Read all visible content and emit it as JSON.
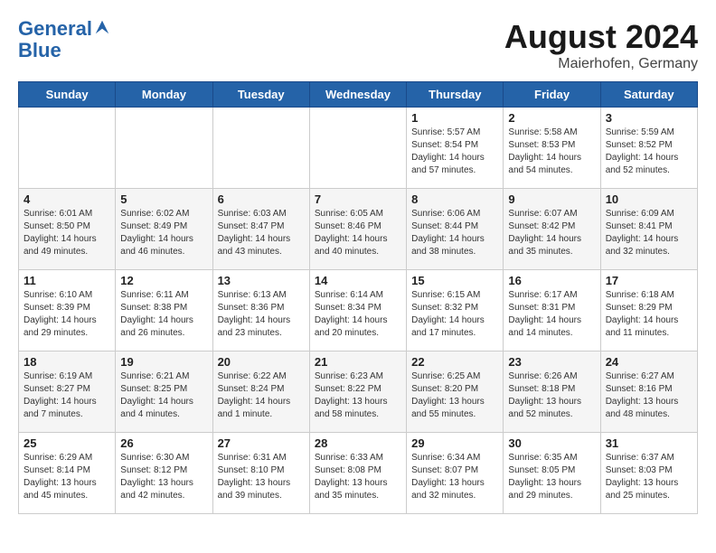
{
  "header": {
    "logo_line1": "General",
    "logo_line2": "Blue",
    "month_year": "August 2024",
    "location": "Maierhofen, Germany"
  },
  "weekdays": [
    "Sunday",
    "Monday",
    "Tuesday",
    "Wednesday",
    "Thursday",
    "Friday",
    "Saturday"
  ],
  "weeks": [
    [
      {
        "day": "",
        "info": ""
      },
      {
        "day": "",
        "info": ""
      },
      {
        "day": "",
        "info": ""
      },
      {
        "day": "",
        "info": ""
      },
      {
        "day": "1",
        "info": "Sunrise: 5:57 AM\nSunset: 8:54 PM\nDaylight: 14 hours\nand 57 minutes."
      },
      {
        "day": "2",
        "info": "Sunrise: 5:58 AM\nSunset: 8:53 PM\nDaylight: 14 hours\nand 54 minutes."
      },
      {
        "day": "3",
        "info": "Sunrise: 5:59 AM\nSunset: 8:52 PM\nDaylight: 14 hours\nand 52 minutes."
      }
    ],
    [
      {
        "day": "4",
        "info": "Sunrise: 6:01 AM\nSunset: 8:50 PM\nDaylight: 14 hours\nand 49 minutes."
      },
      {
        "day": "5",
        "info": "Sunrise: 6:02 AM\nSunset: 8:49 PM\nDaylight: 14 hours\nand 46 minutes."
      },
      {
        "day": "6",
        "info": "Sunrise: 6:03 AM\nSunset: 8:47 PM\nDaylight: 14 hours\nand 43 minutes."
      },
      {
        "day": "7",
        "info": "Sunrise: 6:05 AM\nSunset: 8:46 PM\nDaylight: 14 hours\nand 40 minutes."
      },
      {
        "day": "8",
        "info": "Sunrise: 6:06 AM\nSunset: 8:44 PM\nDaylight: 14 hours\nand 38 minutes."
      },
      {
        "day": "9",
        "info": "Sunrise: 6:07 AM\nSunset: 8:42 PM\nDaylight: 14 hours\nand 35 minutes."
      },
      {
        "day": "10",
        "info": "Sunrise: 6:09 AM\nSunset: 8:41 PM\nDaylight: 14 hours\nand 32 minutes."
      }
    ],
    [
      {
        "day": "11",
        "info": "Sunrise: 6:10 AM\nSunset: 8:39 PM\nDaylight: 14 hours\nand 29 minutes."
      },
      {
        "day": "12",
        "info": "Sunrise: 6:11 AM\nSunset: 8:38 PM\nDaylight: 14 hours\nand 26 minutes."
      },
      {
        "day": "13",
        "info": "Sunrise: 6:13 AM\nSunset: 8:36 PM\nDaylight: 14 hours\nand 23 minutes."
      },
      {
        "day": "14",
        "info": "Sunrise: 6:14 AM\nSunset: 8:34 PM\nDaylight: 14 hours\nand 20 minutes."
      },
      {
        "day": "15",
        "info": "Sunrise: 6:15 AM\nSunset: 8:32 PM\nDaylight: 14 hours\nand 17 minutes."
      },
      {
        "day": "16",
        "info": "Sunrise: 6:17 AM\nSunset: 8:31 PM\nDaylight: 14 hours\nand 14 minutes."
      },
      {
        "day": "17",
        "info": "Sunrise: 6:18 AM\nSunset: 8:29 PM\nDaylight: 14 hours\nand 11 minutes."
      }
    ],
    [
      {
        "day": "18",
        "info": "Sunrise: 6:19 AM\nSunset: 8:27 PM\nDaylight: 14 hours\nand 7 minutes."
      },
      {
        "day": "19",
        "info": "Sunrise: 6:21 AM\nSunset: 8:25 PM\nDaylight: 14 hours\nand 4 minutes."
      },
      {
        "day": "20",
        "info": "Sunrise: 6:22 AM\nSunset: 8:24 PM\nDaylight: 14 hours\nand 1 minute."
      },
      {
        "day": "21",
        "info": "Sunrise: 6:23 AM\nSunset: 8:22 PM\nDaylight: 13 hours\nand 58 minutes."
      },
      {
        "day": "22",
        "info": "Sunrise: 6:25 AM\nSunset: 8:20 PM\nDaylight: 13 hours\nand 55 minutes."
      },
      {
        "day": "23",
        "info": "Sunrise: 6:26 AM\nSunset: 8:18 PM\nDaylight: 13 hours\nand 52 minutes."
      },
      {
        "day": "24",
        "info": "Sunrise: 6:27 AM\nSunset: 8:16 PM\nDaylight: 13 hours\nand 48 minutes."
      }
    ],
    [
      {
        "day": "25",
        "info": "Sunrise: 6:29 AM\nSunset: 8:14 PM\nDaylight: 13 hours\nand 45 minutes."
      },
      {
        "day": "26",
        "info": "Sunrise: 6:30 AM\nSunset: 8:12 PM\nDaylight: 13 hours\nand 42 minutes."
      },
      {
        "day": "27",
        "info": "Sunrise: 6:31 AM\nSunset: 8:10 PM\nDaylight: 13 hours\nand 39 minutes."
      },
      {
        "day": "28",
        "info": "Sunrise: 6:33 AM\nSunset: 8:08 PM\nDaylight: 13 hours\nand 35 minutes."
      },
      {
        "day": "29",
        "info": "Sunrise: 6:34 AM\nSunset: 8:07 PM\nDaylight: 13 hours\nand 32 minutes."
      },
      {
        "day": "30",
        "info": "Sunrise: 6:35 AM\nSunset: 8:05 PM\nDaylight: 13 hours\nand 29 minutes."
      },
      {
        "day": "31",
        "info": "Sunrise: 6:37 AM\nSunset: 8:03 PM\nDaylight: 13 hours\nand 25 minutes."
      }
    ]
  ]
}
